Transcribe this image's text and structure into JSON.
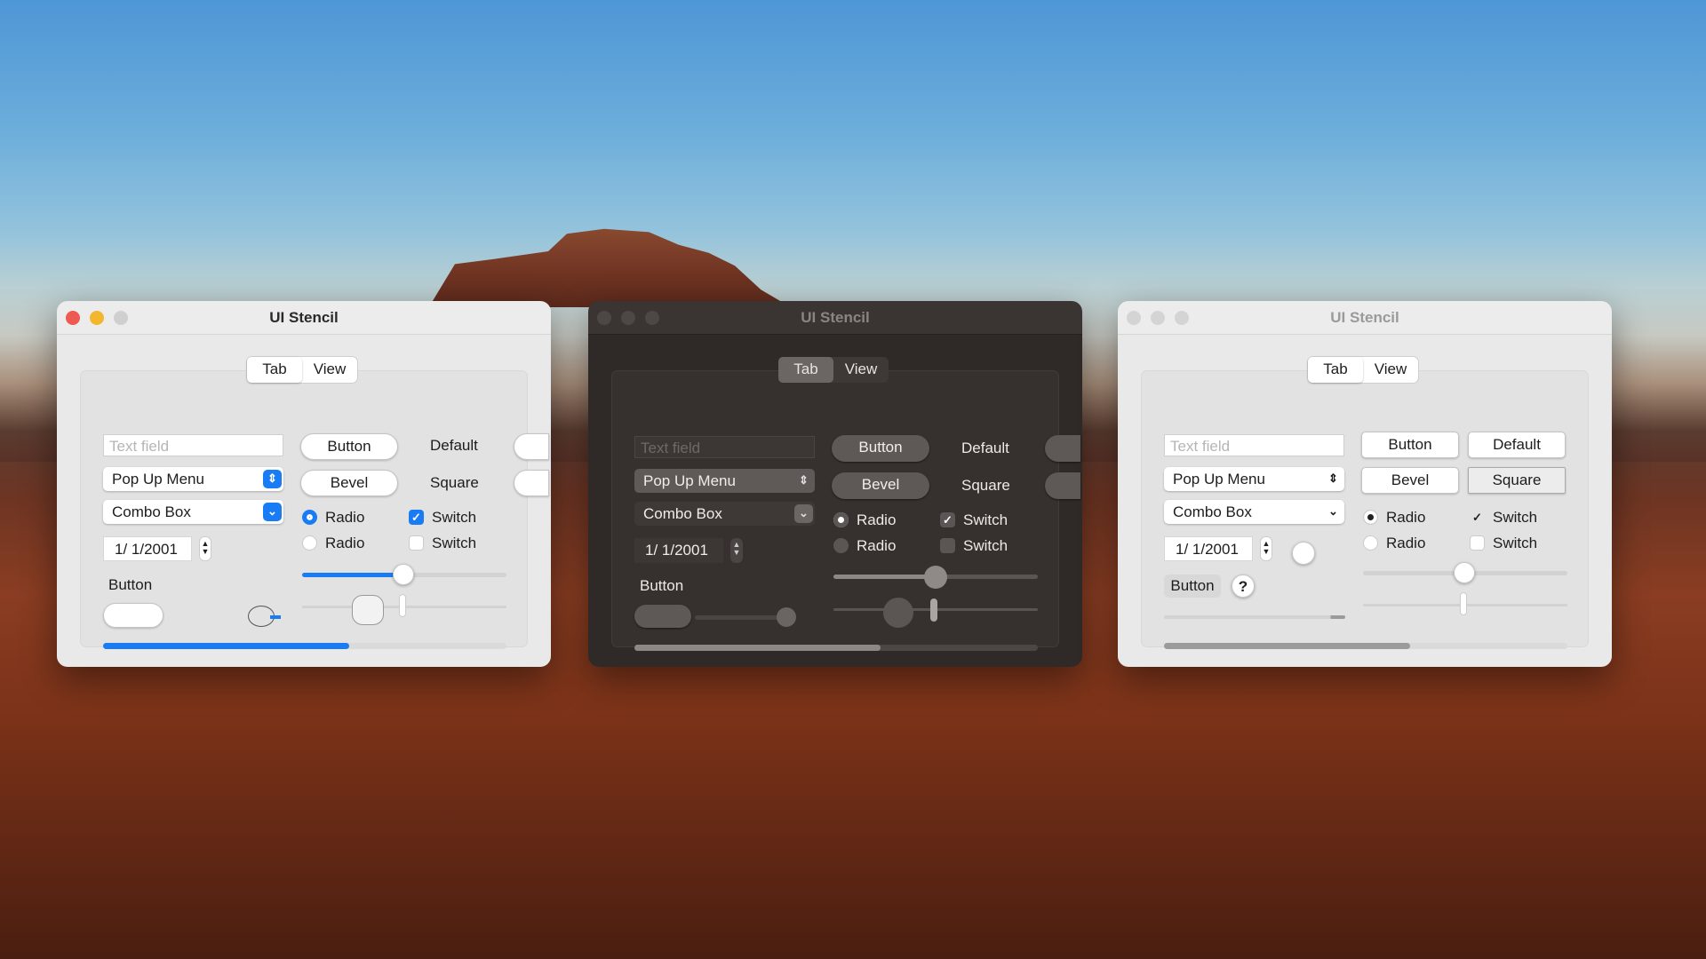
{
  "desktop": {
    "wallpaper": "desert-mesa"
  },
  "windows": [
    {
      "theme": "light",
      "title": "UI Stencil",
      "tabs": [
        "Tab",
        "View"
      ],
      "text_field_placeholder": "Text field",
      "popup": "Pop Up Menu",
      "combo": "Combo Box",
      "date": "1/  1/2001",
      "button": "Button",
      "bevel": "Bevel",
      "default": "Default",
      "square": "Square",
      "radio1": "Radio",
      "radio2": "Radio",
      "switch1": "Switch",
      "switch2": "Switch",
      "small_button": "Button",
      "accent": "#1a7cf5",
      "progress": 0.61
    },
    {
      "theme": "dark",
      "title": "UI Stencil",
      "tabs": [
        "Tab",
        "View"
      ],
      "text_field_placeholder": "Text field",
      "popup": "Pop Up Menu",
      "combo": "Combo Box",
      "date": "1/  1/2001",
      "button": "Button",
      "bevel": "Bevel",
      "default": "Default",
      "square": "Square",
      "radio1": "Radio",
      "radio2": "Radio",
      "switch1": "Switch",
      "switch2": "Switch",
      "small_button": "Button",
      "accent": "#8d8886",
      "progress": 0.61
    },
    {
      "theme": "light-graphite",
      "title": "UI Stencil",
      "tabs": [
        "Tab",
        "View"
      ],
      "text_field_placeholder": "Text field",
      "popup": "Pop Up Menu",
      "combo": "Combo Box",
      "date": "1/  1/2001",
      "button": "Button",
      "bevel": "Bevel",
      "default": "Default",
      "square": "Square",
      "radio1": "Radio",
      "radio2": "Radio",
      "switch1": "Switch",
      "switch2": "Switch",
      "small_button": "Button",
      "help": "?",
      "accent": "#9b9b9b",
      "progress": 0.61
    }
  ]
}
